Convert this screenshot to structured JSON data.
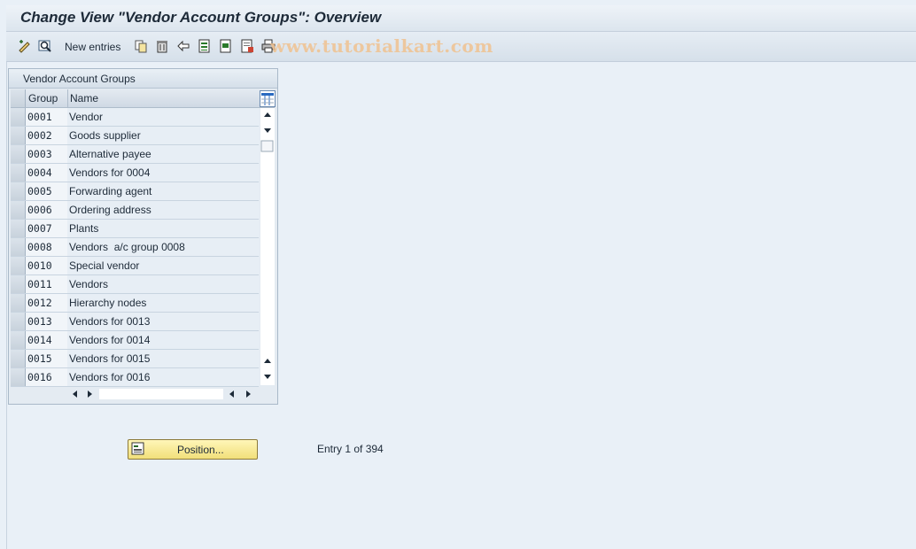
{
  "window": {
    "title": "Change View \"Vendor Account Groups\": Overview",
    "watermark": "www.tutorialkart.com"
  },
  "toolbar": {
    "new_entries_label": "New entries",
    "icons": [
      "display-change-icon",
      "find-icon",
      "copy-icon",
      "delete-icon",
      "undo-icon",
      "select-all-icon",
      "select-block-icon",
      "deselect-all-icon",
      "print-icon"
    ]
  },
  "panel": {
    "title": "Vendor Account Groups",
    "columns": [
      "Group",
      "Name"
    ],
    "rows": [
      {
        "group": "0001",
        "name": "Vendor"
      },
      {
        "group": "0002",
        "name": "Goods supplier"
      },
      {
        "group": "0003",
        "name": "Alternative payee"
      },
      {
        "group": "0004",
        "name": "Vendors for 0004"
      },
      {
        "group": "0005",
        "name": "Forwarding agent"
      },
      {
        "group": "0006",
        "name": "Ordering address"
      },
      {
        "group": "0007",
        "name": "Plants"
      },
      {
        "group": "0008",
        "name": "Vendors  a/c group 0008"
      },
      {
        "group": "0010",
        "name": "Special vendor"
      },
      {
        "group": "0011",
        "name": "Vendors"
      },
      {
        "group": "0012",
        "name": "Hierarchy nodes"
      },
      {
        "group": "0013",
        "name": "Vendors for 0013"
      },
      {
        "group": "0014",
        "name": "Vendors for 0014"
      },
      {
        "group": "0015",
        "name": "Vendors for 0015"
      },
      {
        "group": "0016",
        "name": "Vendors for 0016"
      }
    ]
  },
  "footer": {
    "position_button": "Position...",
    "entry_text": "Entry 1 of 394"
  },
  "colors": {
    "background": "#e9f0f7",
    "button_yellow": "#f1df7a"
  }
}
